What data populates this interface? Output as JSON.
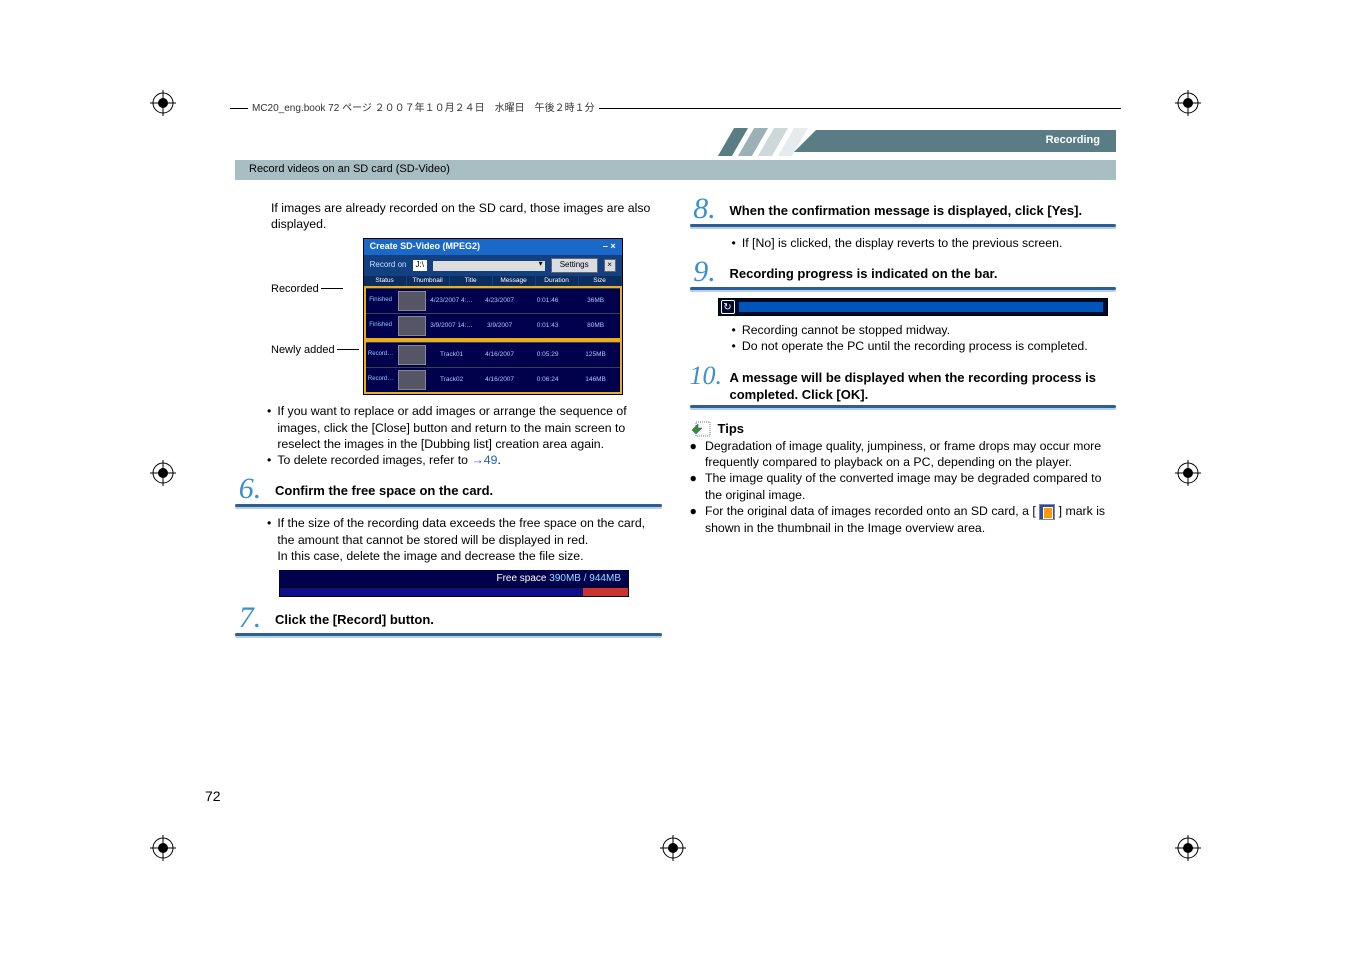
{
  "header": {
    "file_info": "MC20_eng.book  72 ページ  ２００７年１０月２４日　水曜日　午後２時１分",
    "section": "Recording",
    "chapter": "Record videos on an SD card (SD-Video)"
  },
  "left": {
    "intro": "If images are already recorded on the SD card, those images are also displayed.",
    "figure": {
      "label_recorded": "Recorded",
      "label_new": "Newly added",
      "title": "Create SD-Video (MPEG2)",
      "record_on": "Record on",
      "drive": "J:\\",
      "settings": "Settings",
      "cols": [
        "Status",
        "Thumbnail",
        "Title",
        "Message",
        "Duration",
        "Size"
      ],
      "rows": [
        {
          "status": "Finished",
          "title": "4/23/2007 4:…",
          "msg": "4/23/2007",
          "dur": "0:01:46",
          "size": "36MB"
        },
        {
          "status": "Finished",
          "title": "3/9/2007 14:…",
          "msg": "3/9/2007",
          "dur": "0:01:43",
          "size": "80MB"
        },
        {
          "status": "Record…",
          "title": "Track01",
          "msg": "4/16/2007",
          "dur": "0:05:29",
          "size": "125MB"
        },
        {
          "status": "Record…",
          "title": "Track02",
          "msg": "4/16/2007",
          "dur": "0:06:24",
          "size": "146MB"
        }
      ]
    },
    "bullets": {
      "0": "If you want to replace or add images or arrange the sequence of images, click the [Close] button and return to the main screen to reselect the images in the [Dubbing list] creation area again.",
      "1a": "To delete recorded images, refer to",
      "1link": "49",
      "1b": "."
    },
    "step6": {
      "num": "6.",
      "title": "Confirm the free space on the card.",
      "body1": "If the size of the recording data exceeds the free space on the card, the amount that cannot be stored will be displayed in red.",
      "body2": "In this case, delete the image and decrease the file size."
    },
    "freespace": {
      "label": "Free space",
      "value": "390MB / 944MB"
    },
    "step7": {
      "num": "7.",
      "title": "Click the [Record] button."
    }
  },
  "right": {
    "step8": {
      "num": "8.",
      "title": "When the confirmation message is displayed, click [Yes].",
      "body": "If [No] is clicked, the display reverts to the previous screen."
    },
    "step9": {
      "num": "9.",
      "title": "Recording progress is indicated on the bar.",
      "b1": "Recording cannot be stopped midway.",
      "b2": "Do not operate the PC until the recording process is completed."
    },
    "step10": {
      "num": "10.",
      "title": "A message will be displayed when the recording process is completed. Click [OK]."
    },
    "tips": {
      "heading": "Tips",
      "items": {
        "0": "Degradation of image quality, jumpiness, or frame drops may occur more frequently compared to playback on a PC, depending on the player.",
        "1": "The image quality of the converted image may be degraded compared to the original image.",
        "2a": "For the original data of images recorded onto an SD card, a [",
        "2b": "] mark is shown in the thumbnail in the Image overview area."
      }
    }
  },
  "page_number": "72"
}
